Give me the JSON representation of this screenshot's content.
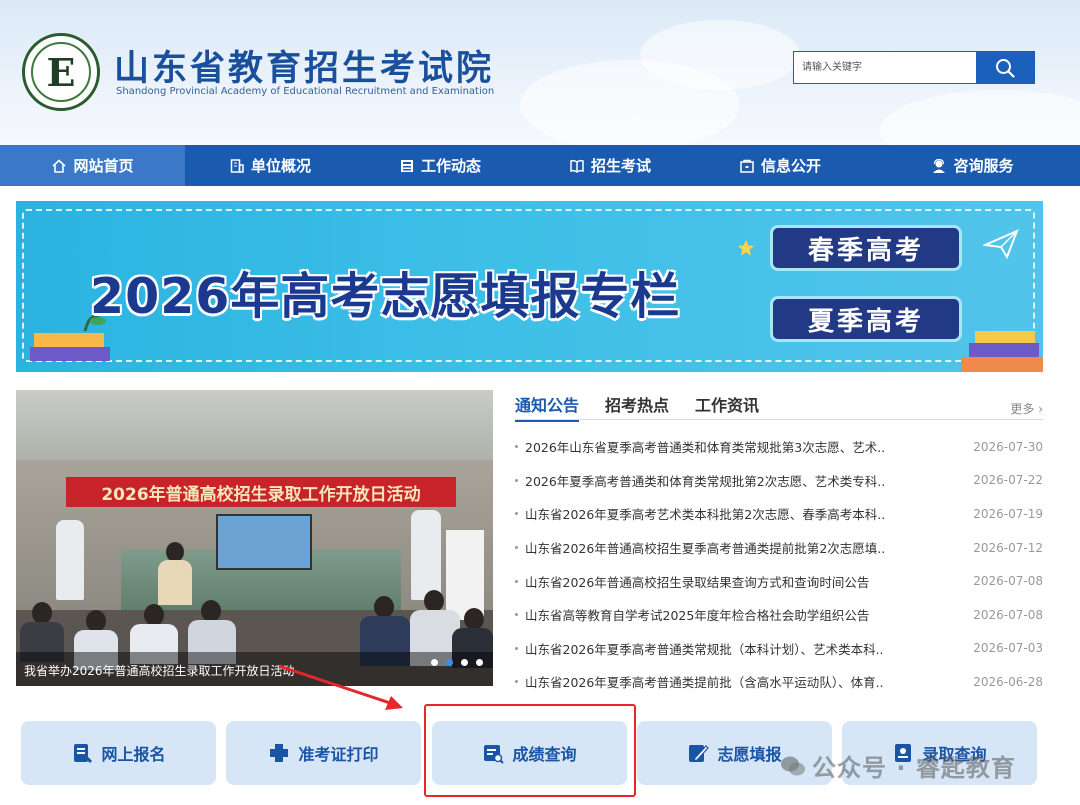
{
  "header": {
    "logo_letter": "E",
    "title": "山东省教育招生考试院",
    "subtitle": "Shandong Provincial Academy of Educational Recruitment and Examination",
    "search_placeholder": "请输入关键字"
  },
  "nav": {
    "items": [
      {
        "label": "网站首页",
        "icon": "home-icon"
      },
      {
        "label": "单位概况",
        "icon": "building-icon"
      },
      {
        "label": "工作动态",
        "icon": "news-icon"
      },
      {
        "label": "招生考试",
        "icon": "book-icon"
      },
      {
        "label": "信息公开",
        "icon": "info-icon"
      },
      {
        "label": "咨询服务",
        "icon": "support-icon"
      }
    ]
  },
  "banner": {
    "headline": "2026年高考志愿填报专栏",
    "spring_label": "春季高考",
    "summer_label": "夏季高考"
  },
  "slideshow": {
    "photo_banner_text": "2026年普通高校招生录取工作开放日活动",
    "caption": "我省举办2026年普通高校招生录取工作开放日活动",
    "slide_count": 4,
    "active_slide": 2
  },
  "news": {
    "tabs": [
      "通知公告",
      "招考热点",
      "工作资讯"
    ],
    "active_tab": "通知公告",
    "more_label": "更多",
    "items": [
      {
        "title": "2026年山东省夏季高考普通类和体育类常规批第3次志愿、艺术..",
        "date": "2026-07-30"
      },
      {
        "title": "2026年夏季高考普通类和体育类常规批第2次志愿、艺术类专科..",
        "date": "2026-07-22"
      },
      {
        "title": "山东省2026年夏季高考艺术类本科批第2次志愿、春季高考本科..",
        "date": "2026-07-19"
      },
      {
        "title": "山东省2026年普通高校招生夏季高考普通类提前批第2次志愿填..",
        "date": "2026-07-12"
      },
      {
        "title": "山东省2026年普通高校招生录取结果查询方式和查询时间公告",
        "date": "2026-07-08"
      },
      {
        "title": "山东省高等教育自学考试2025年度年检合格社会助学组织公告",
        "date": "2026-07-08"
      },
      {
        "title": "山东省2026年夏季高考普通类常规批（本科计划）、艺术类本科..",
        "date": "2026-07-03"
      },
      {
        "title": "山东省2026年夏季高考普通类提前批（含高水平运动队）、体育..",
        "date": "2026-06-28"
      }
    ]
  },
  "quick_links": [
    {
      "label": "网上报名",
      "icon": "register-icon"
    },
    {
      "label": "准考证打印",
      "icon": "print-icon"
    },
    {
      "label": "成绩查询",
      "icon": "score-icon"
    },
    {
      "label": "志愿填报",
      "icon": "application-icon"
    },
    {
      "label": "录取查询",
      "icon": "admission-icon"
    }
  ],
  "watermark": {
    "text": "公众号 · 睿匙教育"
  },
  "colors": {
    "nav_bg": "#1a5bb0",
    "nav_active": "#3b78c7",
    "accent": "#1a5bb0",
    "highlight": "#e6262a",
    "quick_btn_bg": "#d6e6f7"
  }
}
